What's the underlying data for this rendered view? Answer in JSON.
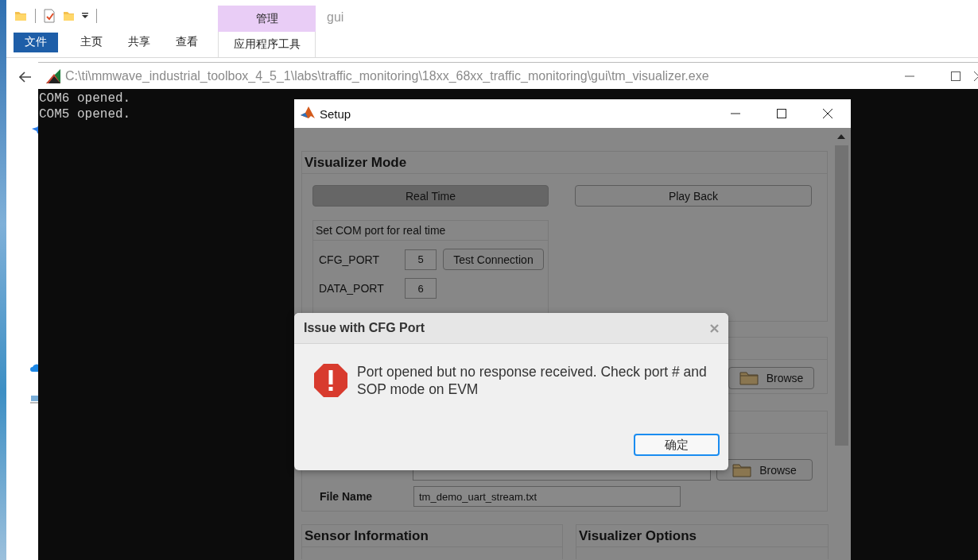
{
  "explorer": {
    "context_tab": "管理",
    "folder_title": "gui",
    "ribbon_tabs": [
      {
        "label": "文件",
        "kind": "file"
      },
      {
        "label": "主页",
        "kind": "plain"
      },
      {
        "label": "共享",
        "kind": "plain"
      },
      {
        "label": "查看",
        "kind": "plain"
      },
      {
        "label": "应用程序工具",
        "kind": "context"
      }
    ]
  },
  "console": {
    "title": "C:\\ti\\mmwave_industrial_toolbox_4_5_1\\labs\\traffic_monitoring\\18xx_68xx_traffic_monitoring\\gui\\tm_visualizer.exe",
    "lines": [
      "COM6 opened.",
      "COM5 opened."
    ]
  },
  "setup": {
    "title": "Setup",
    "visualizer_mode": {
      "heading": "Visualizer Mode",
      "modes": [
        {
          "label": "Real Time",
          "selected": true
        },
        {
          "label": "Play Back",
          "selected": false
        }
      ],
      "com_port": {
        "heading": "Set COM port for real time",
        "test_button": "Test Connection",
        "ports": [
          {
            "label": "CFG_PORT",
            "value": "5"
          },
          {
            "label": "DATA_PORT",
            "value": "6"
          }
        ]
      }
    },
    "source": {
      "browse_button": "Browse"
    },
    "recording": {
      "browse_button": "Browse",
      "file_name_label": "File Name",
      "file_name": "tm_demo_uart_stream.txt"
    },
    "sensor_information": {
      "heading": "Sensor Information"
    },
    "visualizer_options": {
      "heading": "Visualizer Options"
    }
  },
  "dialog": {
    "title": "Issue with CFG Port",
    "message": "Port opened but no response received. Check port # and SOP mode on EVM",
    "buttons": [
      {
        "label": "确定",
        "focused": true
      }
    ]
  }
}
